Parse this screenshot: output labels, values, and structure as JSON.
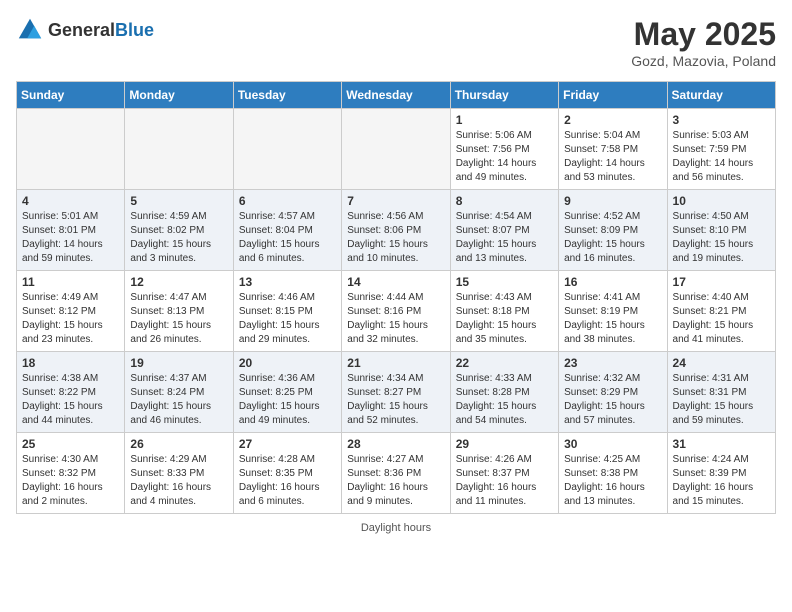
{
  "header": {
    "logo_general": "General",
    "logo_blue": "Blue",
    "month_title": "May 2025",
    "location": "Gozd, Mazovia, Poland"
  },
  "days_of_week": [
    "Sunday",
    "Monday",
    "Tuesday",
    "Wednesday",
    "Thursday",
    "Friday",
    "Saturday"
  ],
  "weeks": [
    {
      "id": "week1",
      "days": [
        {
          "day": "",
          "empty": true
        },
        {
          "day": "",
          "empty": true
        },
        {
          "day": "",
          "empty": true
        },
        {
          "day": "",
          "empty": true
        },
        {
          "day": "1",
          "sunrise": "5:06 AM",
          "sunset": "7:56 PM",
          "daylight": "14 hours and 49 minutes."
        },
        {
          "day": "2",
          "sunrise": "5:04 AM",
          "sunset": "7:58 PM",
          "daylight": "14 hours and 53 minutes."
        },
        {
          "day": "3",
          "sunrise": "5:03 AM",
          "sunset": "7:59 PM",
          "daylight": "14 hours and 56 minutes."
        }
      ]
    },
    {
      "id": "week2",
      "days": [
        {
          "day": "4",
          "sunrise": "5:01 AM",
          "sunset": "8:01 PM",
          "daylight": "14 hours and 59 minutes."
        },
        {
          "day": "5",
          "sunrise": "4:59 AM",
          "sunset": "8:02 PM",
          "daylight": "15 hours and 3 minutes."
        },
        {
          "day": "6",
          "sunrise": "4:57 AM",
          "sunset": "8:04 PM",
          "daylight": "15 hours and 6 minutes."
        },
        {
          "day": "7",
          "sunrise": "4:56 AM",
          "sunset": "8:06 PM",
          "daylight": "15 hours and 10 minutes."
        },
        {
          "day": "8",
          "sunrise": "4:54 AM",
          "sunset": "8:07 PM",
          "daylight": "15 hours and 13 minutes."
        },
        {
          "day": "9",
          "sunrise": "4:52 AM",
          "sunset": "8:09 PM",
          "daylight": "15 hours and 16 minutes."
        },
        {
          "day": "10",
          "sunrise": "4:50 AM",
          "sunset": "8:10 PM",
          "daylight": "15 hours and 19 minutes."
        }
      ]
    },
    {
      "id": "week3",
      "days": [
        {
          "day": "11",
          "sunrise": "4:49 AM",
          "sunset": "8:12 PM",
          "daylight": "15 hours and 23 minutes."
        },
        {
          "day": "12",
          "sunrise": "4:47 AM",
          "sunset": "8:13 PM",
          "daylight": "15 hours and 26 minutes."
        },
        {
          "day": "13",
          "sunrise": "4:46 AM",
          "sunset": "8:15 PM",
          "daylight": "15 hours and 29 minutes."
        },
        {
          "day": "14",
          "sunrise": "4:44 AM",
          "sunset": "8:16 PM",
          "daylight": "15 hours and 32 minutes."
        },
        {
          "day": "15",
          "sunrise": "4:43 AM",
          "sunset": "8:18 PM",
          "daylight": "15 hours and 35 minutes."
        },
        {
          "day": "16",
          "sunrise": "4:41 AM",
          "sunset": "8:19 PM",
          "daylight": "15 hours and 38 minutes."
        },
        {
          "day": "17",
          "sunrise": "4:40 AM",
          "sunset": "8:21 PM",
          "daylight": "15 hours and 41 minutes."
        }
      ]
    },
    {
      "id": "week4",
      "days": [
        {
          "day": "18",
          "sunrise": "4:38 AM",
          "sunset": "8:22 PM",
          "daylight": "15 hours and 44 minutes."
        },
        {
          "day": "19",
          "sunrise": "4:37 AM",
          "sunset": "8:24 PM",
          "daylight": "15 hours and 46 minutes."
        },
        {
          "day": "20",
          "sunrise": "4:36 AM",
          "sunset": "8:25 PM",
          "daylight": "15 hours and 49 minutes."
        },
        {
          "day": "21",
          "sunrise": "4:34 AM",
          "sunset": "8:27 PM",
          "daylight": "15 hours and 52 minutes."
        },
        {
          "day": "22",
          "sunrise": "4:33 AM",
          "sunset": "8:28 PM",
          "daylight": "15 hours and 54 minutes."
        },
        {
          "day": "23",
          "sunrise": "4:32 AM",
          "sunset": "8:29 PM",
          "daylight": "15 hours and 57 minutes."
        },
        {
          "day": "24",
          "sunrise": "4:31 AM",
          "sunset": "8:31 PM",
          "daylight": "15 hours and 59 minutes."
        }
      ]
    },
    {
      "id": "week5",
      "days": [
        {
          "day": "25",
          "sunrise": "4:30 AM",
          "sunset": "8:32 PM",
          "daylight": "16 hours and 2 minutes."
        },
        {
          "day": "26",
          "sunrise": "4:29 AM",
          "sunset": "8:33 PM",
          "daylight": "16 hours and 4 minutes."
        },
        {
          "day": "27",
          "sunrise": "4:28 AM",
          "sunset": "8:35 PM",
          "daylight": "16 hours and 6 minutes."
        },
        {
          "day": "28",
          "sunrise": "4:27 AM",
          "sunset": "8:36 PM",
          "daylight": "16 hours and 9 minutes."
        },
        {
          "day": "29",
          "sunrise": "4:26 AM",
          "sunset": "8:37 PM",
          "daylight": "16 hours and 11 minutes."
        },
        {
          "day": "30",
          "sunrise": "4:25 AM",
          "sunset": "8:38 PM",
          "daylight": "16 hours and 13 minutes."
        },
        {
          "day": "31",
          "sunrise": "4:24 AM",
          "sunset": "8:39 PM",
          "daylight": "16 hours and 15 minutes."
        }
      ]
    }
  ],
  "footer": {
    "daylight_label": "Daylight hours"
  }
}
